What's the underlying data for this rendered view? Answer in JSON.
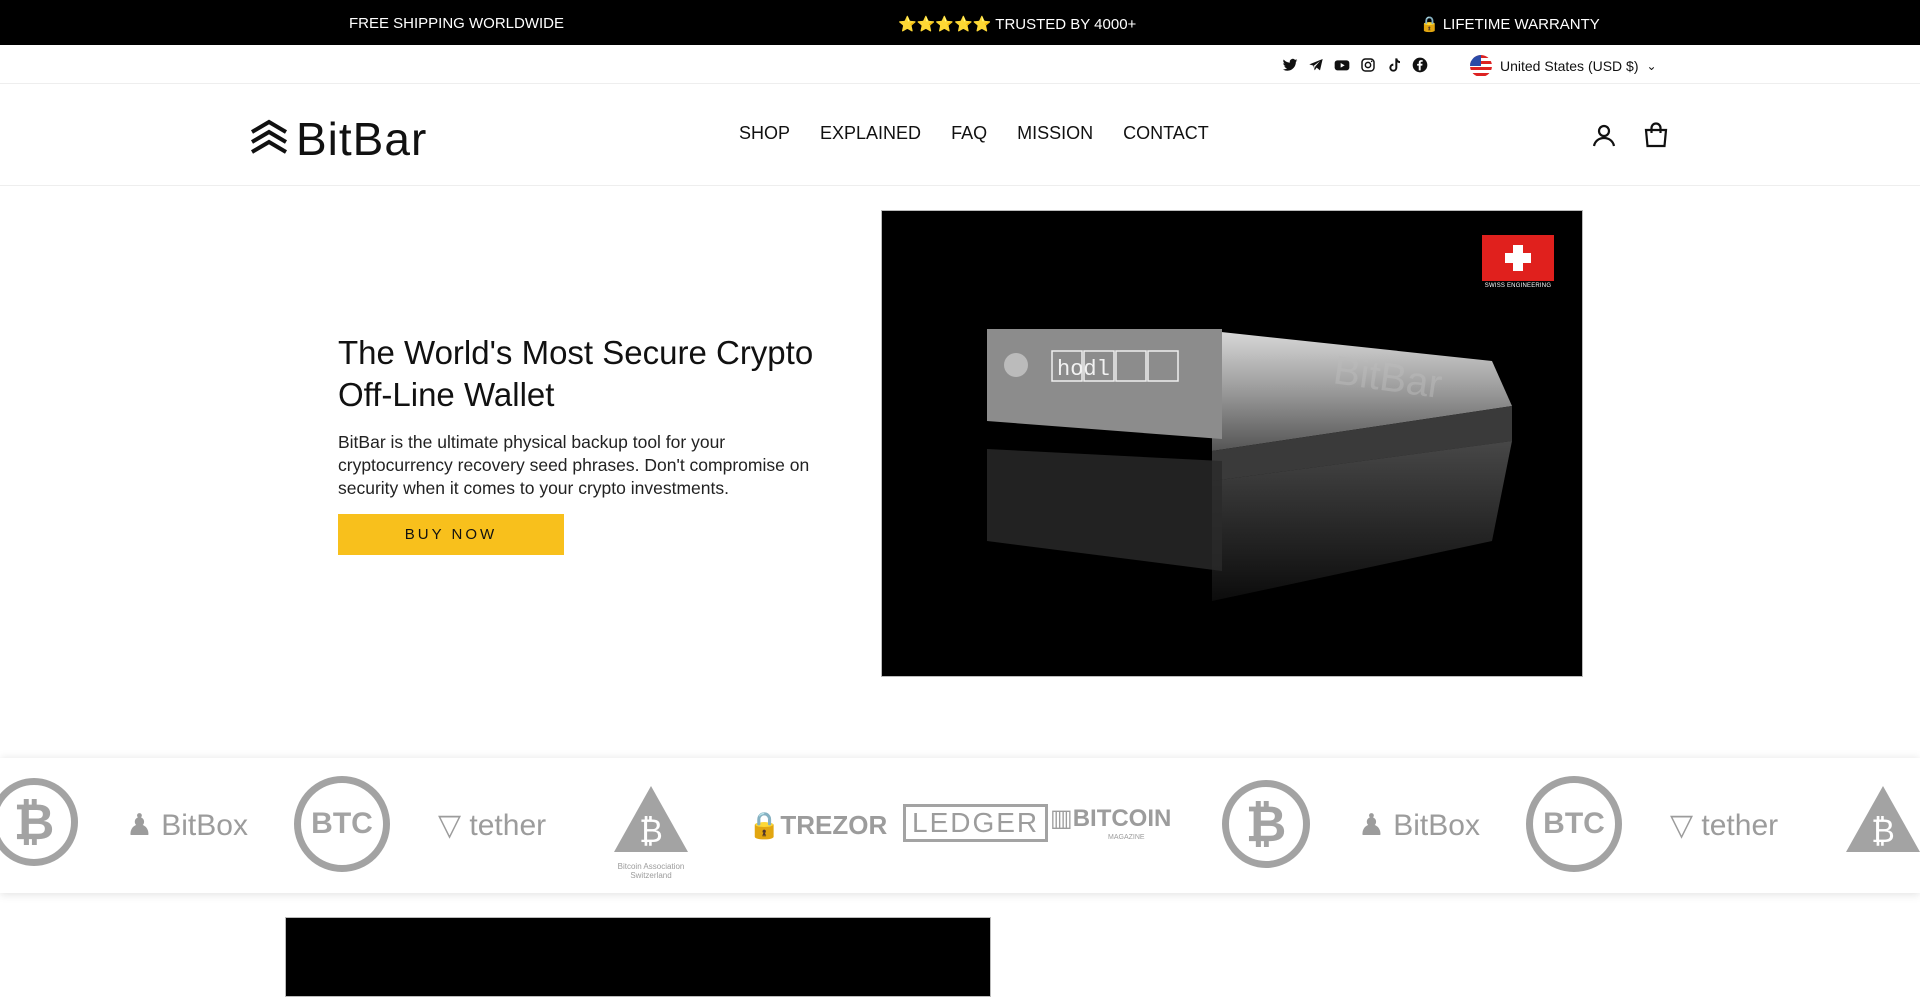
{
  "announcement": {
    "shipping": "FREE SHIPPING WORLDWIDE",
    "trusted": "⭐⭐⭐⭐⭐ TRUSTED BY 4000+",
    "warranty": "🔒 LIFETIME WARRANTY"
  },
  "social": [
    "twitter-icon",
    "telegram-icon",
    "youtube-icon",
    "instagram-icon",
    "tiktok-icon",
    "facebook-icon"
  ],
  "currency": {
    "label": "United States (USD $)"
  },
  "header": {
    "logo_text": "BitBar",
    "nav": [
      "SHOP",
      "EXPLAINED",
      "FAQ",
      "MISSION",
      "CONTACT"
    ]
  },
  "hero": {
    "title": "The World's Most Secure Crypto Off-Line Wallet",
    "text": "BitBar is the ultimate physical backup tool for your cryptocurrency recovery seed phrases. Don't compromise on security when it comes to your crypto investments.",
    "button": "BUY NOW",
    "product_engraving": "BitBar",
    "badge_label": "SWISS ENGINEERING",
    "letter_tiles": "hodl"
  },
  "partners": [
    "BitBox",
    "BTC",
    "tether",
    "Bitcoin Association Switzerland",
    "TREZOR",
    "LEDGER",
    "BITCOIN",
    "MAGAZINE"
  ],
  "colors": {
    "accent": "#f8c01c",
    "announcement_bg": "#000000",
    "logo_gray": "#9c9c9c"
  }
}
